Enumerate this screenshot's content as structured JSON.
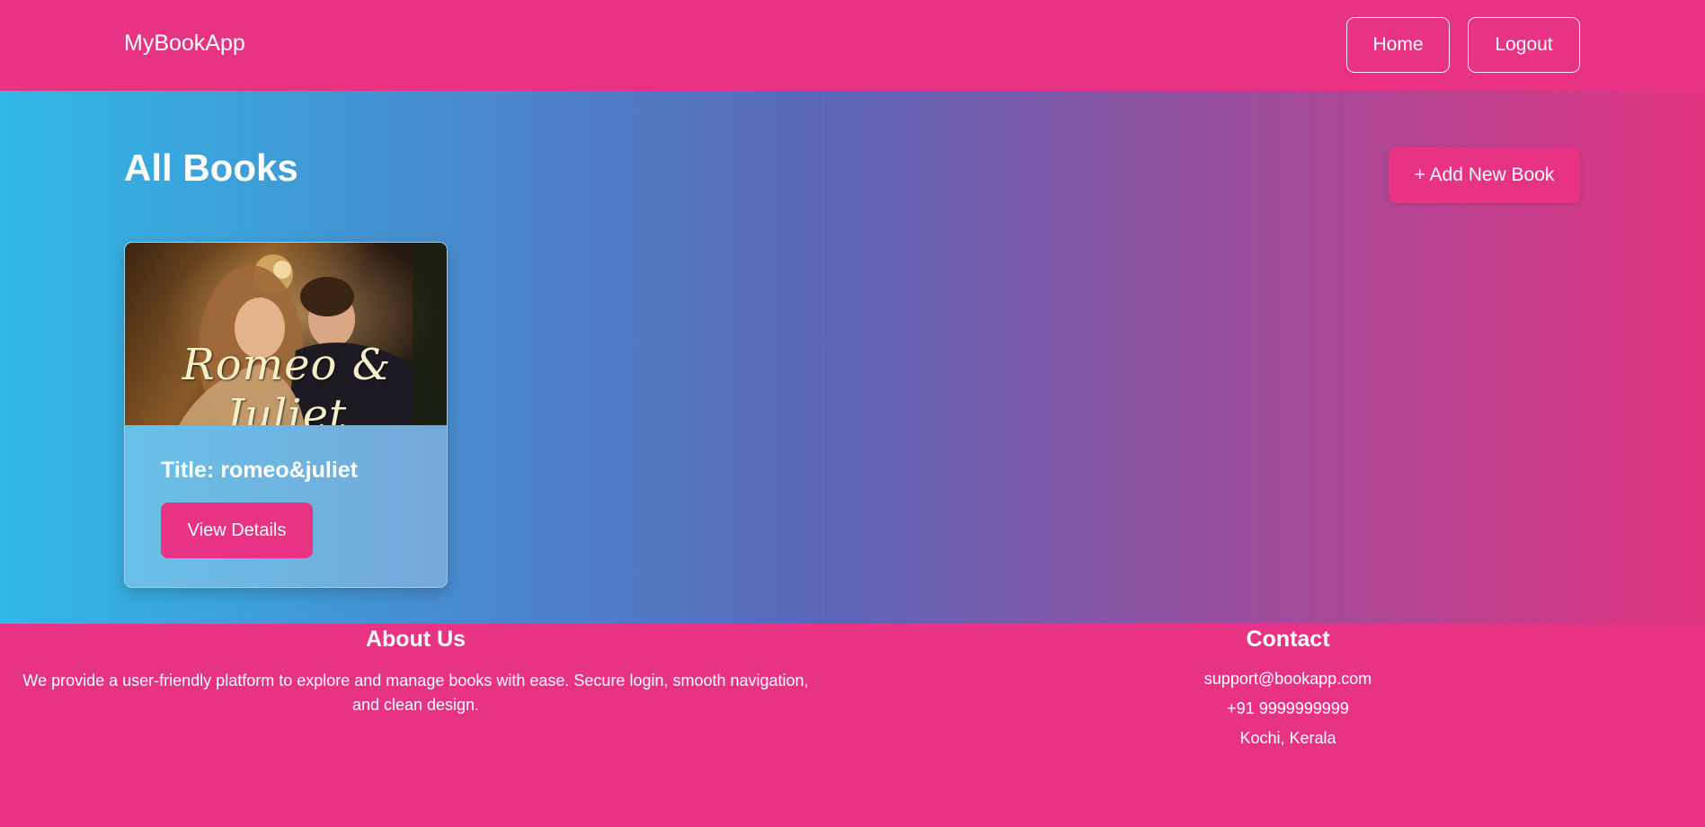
{
  "navbar": {
    "brand": "MyBookApp",
    "links": [
      {
        "label": "Home"
      },
      {
        "label": "Logout"
      }
    ]
  },
  "main": {
    "title": "All Books",
    "add_button_label": "+ Add New Book",
    "books": [
      {
        "image_caption": "Romeo & Juliet",
        "title_text": "Title: romeo&juliet",
        "view_button_label": "View Details"
      }
    ]
  },
  "footer": {
    "about": {
      "heading": "About Us",
      "text": "We provide a user-friendly platform to explore and manage books with ease. Secure login, smooth navigation, and clean design."
    },
    "contact": {
      "heading": "Contact",
      "email": "support@bookapp.com",
      "phone": "+91 9999999999",
      "location": "Kochi, Kerala"
    }
  },
  "colors": {
    "primary": "#e83385",
    "gradient_start": "#30b8e6",
    "gradient_mid": "#5a67b8",
    "gradient_end": "#e2337f",
    "text": "#ffffff"
  }
}
